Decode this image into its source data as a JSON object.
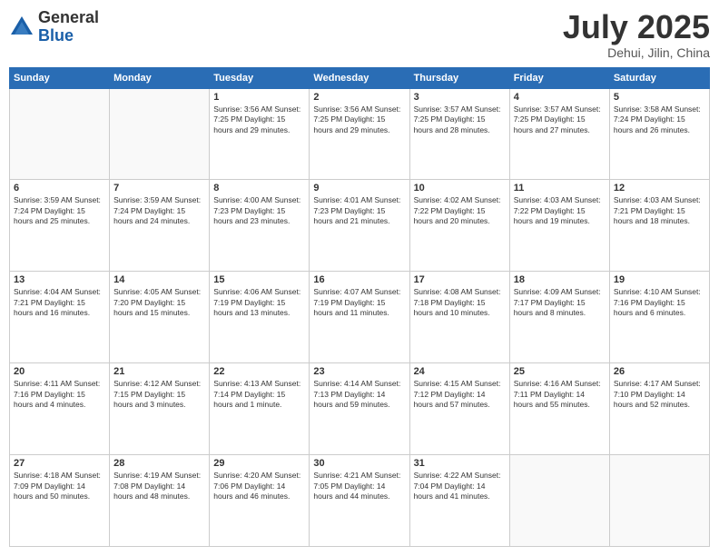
{
  "logo": {
    "general": "General",
    "blue": "Blue"
  },
  "header": {
    "month": "July 2025",
    "location": "Dehui, Jilin, China"
  },
  "days_of_week": [
    "Sunday",
    "Monday",
    "Tuesday",
    "Wednesday",
    "Thursday",
    "Friday",
    "Saturday"
  ],
  "weeks": [
    [
      {
        "day": "",
        "info": ""
      },
      {
        "day": "",
        "info": ""
      },
      {
        "day": "1",
        "info": "Sunrise: 3:56 AM\nSunset: 7:25 PM\nDaylight: 15 hours\nand 29 minutes."
      },
      {
        "day": "2",
        "info": "Sunrise: 3:56 AM\nSunset: 7:25 PM\nDaylight: 15 hours\nand 29 minutes."
      },
      {
        "day": "3",
        "info": "Sunrise: 3:57 AM\nSunset: 7:25 PM\nDaylight: 15 hours\nand 28 minutes."
      },
      {
        "day": "4",
        "info": "Sunrise: 3:57 AM\nSunset: 7:25 PM\nDaylight: 15 hours\nand 27 minutes."
      },
      {
        "day": "5",
        "info": "Sunrise: 3:58 AM\nSunset: 7:24 PM\nDaylight: 15 hours\nand 26 minutes."
      }
    ],
    [
      {
        "day": "6",
        "info": "Sunrise: 3:59 AM\nSunset: 7:24 PM\nDaylight: 15 hours\nand 25 minutes."
      },
      {
        "day": "7",
        "info": "Sunrise: 3:59 AM\nSunset: 7:24 PM\nDaylight: 15 hours\nand 24 minutes."
      },
      {
        "day": "8",
        "info": "Sunrise: 4:00 AM\nSunset: 7:23 PM\nDaylight: 15 hours\nand 23 minutes."
      },
      {
        "day": "9",
        "info": "Sunrise: 4:01 AM\nSunset: 7:23 PM\nDaylight: 15 hours\nand 21 minutes."
      },
      {
        "day": "10",
        "info": "Sunrise: 4:02 AM\nSunset: 7:22 PM\nDaylight: 15 hours\nand 20 minutes."
      },
      {
        "day": "11",
        "info": "Sunrise: 4:03 AM\nSunset: 7:22 PM\nDaylight: 15 hours\nand 19 minutes."
      },
      {
        "day": "12",
        "info": "Sunrise: 4:03 AM\nSunset: 7:21 PM\nDaylight: 15 hours\nand 18 minutes."
      }
    ],
    [
      {
        "day": "13",
        "info": "Sunrise: 4:04 AM\nSunset: 7:21 PM\nDaylight: 15 hours\nand 16 minutes."
      },
      {
        "day": "14",
        "info": "Sunrise: 4:05 AM\nSunset: 7:20 PM\nDaylight: 15 hours\nand 15 minutes."
      },
      {
        "day": "15",
        "info": "Sunrise: 4:06 AM\nSunset: 7:19 PM\nDaylight: 15 hours\nand 13 minutes."
      },
      {
        "day": "16",
        "info": "Sunrise: 4:07 AM\nSunset: 7:19 PM\nDaylight: 15 hours\nand 11 minutes."
      },
      {
        "day": "17",
        "info": "Sunrise: 4:08 AM\nSunset: 7:18 PM\nDaylight: 15 hours\nand 10 minutes."
      },
      {
        "day": "18",
        "info": "Sunrise: 4:09 AM\nSunset: 7:17 PM\nDaylight: 15 hours\nand 8 minutes."
      },
      {
        "day": "19",
        "info": "Sunrise: 4:10 AM\nSunset: 7:16 PM\nDaylight: 15 hours\nand 6 minutes."
      }
    ],
    [
      {
        "day": "20",
        "info": "Sunrise: 4:11 AM\nSunset: 7:16 PM\nDaylight: 15 hours\nand 4 minutes."
      },
      {
        "day": "21",
        "info": "Sunrise: 4:12 AM\nSunset: 7:15 PM\nDaylight: 15 hours\nand 3 minutes."
      },
      {
        "day": "22",
        "info": "Sunrise: 4:13 AM\nSunset: 7:14 PM\nDaylight: 15 hours\nand 1 minute."
      },
      {
        "day": "23",
        "info": "Sunrise: 4:14 AM\nSunset: 7:13 PM\nDaylight: 14 hours\nand 59 minutes."
      },
      {
        "day": "24",
        "info": "Sunrise: 4:15 AM\nSunset: 7:12 PM\nDaylight: 14 hours\nand 57 minutes."
      },
      {
        "day": "25",
        "info": "Sunrise: 4:16 AM\nSunset: 7:11 PM\nDaylight: 14 hours\nand 55 minutes."
      },
      {
        "day": "26",
        "info": "Sunrise: 4:17 AM\nSunset: 7:10 PM\nDaylight: 14 hours\nand 52 minutes."
      }
    ],
    [
      {
        "day": "27",
        "info": "Sunrise: 4:18 AM\nSunset: 7:09 PM\nDaylight: 14 hours\nand 50 minutes."
      },
      {
        "day": "28",
        "info": "Sunrise: 4:19 AM\nSunset: 7:08 PM\nDaylight: 14 hours\nand 48 minutes."
      },
      {
        "day": "29",
        "info": "Sunrise: 4:20 AM\nSunset: 7:06 PM\nDaylight: 14 hours\nand 46 minutes."
      },
      {
        "day": "30",
        "info": "Sunrise: 4:21 AM\nSunset: 7:05 PM\nDaylight: 14 hours\nand 44 minutes."
      },
      {
        "day": "31",
        "info": "Sunrise: 4:22 AM\nSunset: 7:04 PM\nDaylight: 14 hours\nand 41 minutes."
      },
      {
        "day": "",
        "info": ""
      },
      {
        "day": "",
        "info": ""
      }
    ]
  ]
}
